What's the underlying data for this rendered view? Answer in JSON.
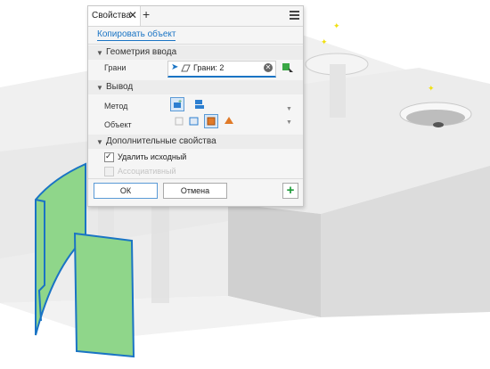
{
  "panel": {
    "tab_label": "Свойства",
    "close_glyph": "✕",
    "add_glyph": "+",
    "copy_link": "Копировать объект",
    "sections": {
      "input_geometry": "Геометрия ввода",
      "output": "Вывод",
      "additional": "Дополнительные свойства"
    },
    "faces_label": "Грани",
    "faces_value": "Грани: 2",
    "method_label": "Метод",
    "object_label": "Объект",
    "delete_original_label": "Удалить исходный",
    "delete_original_checked": true,
    "associative_label": "Ассоциативный",
    "associative_enabled": false,
    "ok_label": "ОК",
    "cancel_label": "Отмена",
    "add_glyph_footer": "+"
  },
  "icons": [
    "close-icon",
    "add-tab-icon",
    "menu-icon",
    "cursor-arrow-icon",
    "face-icon",
    "clear-icon",
    "select-tool-icon",
    "surface-output-icon",
    "solid-output-icon",
    "composite-icon",
    "mesh-icon",
    "solid-body-icon",
    "repair-icon",
    "dropdown-icon",
    "plus-icon"
  ],
  "colors": {
    "accent": "#1a74c4",
    "selected_faces": "#8fd68a",
    "face_edge": "#1a74c4",
    "marker": "#f0e010"
  }
}
